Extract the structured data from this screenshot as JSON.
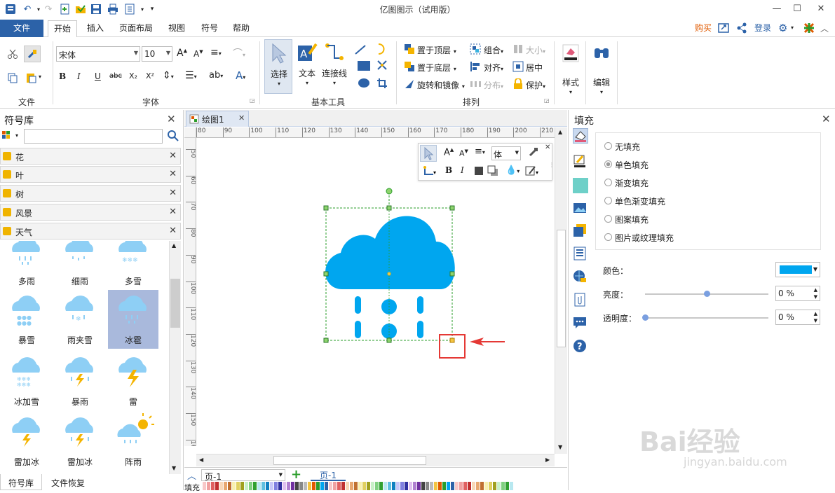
{
  "app": {
    "title": "亿图图示（试用版）"
  },
  "menu": {
    "file": "文件",
    "tabs": [
      "开始",
      "插入",
      "页面布局",
      "视图",
      "符号",
      "帮助"
    ],
    "buy": "购买",
    "login": "登录"
  },
  "ribbon": {
    "groups": {
      "file": "文件",
      "font": "字体",
      "basic_tools": "基本工具",
      "arrange": "排列",
      "style": "样式",
      "edit": "编辑"
    },
    "font_name": "宋体",
    "font_size": "10",
    "select": "选择",
    "text": "文本",
    "connector": "连接线",
    "bring_front": "置于顶层",
    "send_back": "置于底层",
    "rotate_mirror": "旋转和镜像",
    "group": "组合",
    "align": "对齐",
    "distribute": "分布",
    "size": "大小",
    "center": "居中",
    "protect": "保护",
    "bold": "B",
    "italic": "I",
    "underline": "U",
    "strike": "abc",
    "sub": "X₂",
    "sup": "X²"
  },
  "left_panel": {
    "title": "符号库",
    "search_placeholder": "",
    "categories": [
      "花",
      "叶",
      "树",
      "风景",
      "天气"
    ],
    "symbols": [
      "多雨",
      "细雨",
      "多雪",
      "暴雪",
      "雨夹雪",
      "冰雹",
      "冰加雪",
      "暴雨",
      "雷",
      "雷加冰",
      "雷加冰",
      "阵雨"
    ],
    "bottom_tabs": [
      "符号库",
      "文件恢复"
    ]
  },
  "canvas": {
    "tab": "绘图1",
    "ruler_top": [
      "80",
      "90",
      "100",
      "110",
      "120",
      "130",
      "140",
      "150",
      "160",
      "170",
      "180",
      "190",
      "200",
      "210"
    ],
    "ruler_left": [
      "50",
      "60",
      "70",
      "80",
      "90",
      "100",
      "110",
      "120",
      "130",
      "140",
      "150",
      "160"
    ],
    "mini_font": "体",
    "page_select": "页-1",
    "page_tab": "页-1",
    "fill_label": "填充"
  },
  "right_panel": {
    "title": "填充",
    "options": [
      "无填充",
      "单色填充",
      "渐变填充",
      "单色渐变填充",
      "图案填充",
      "图片或纹理填充"
    ],
    "selected_option": "单色填充",
    "color_label": "颜色：",
    "color_value": "#00a6ef",
    "brightness_label": "亮度：",
    "brightness_value": "0 %",
    "brightness_level": 0.5,
    "transparency_label": "透明度：",
    "transparency_value": "0 %",
    "transparency_level": 0
  },
  "watermark": {
    "brand": "Bai经验",
    "url": "jingyan.baidu.com"
  },
  "colors": {
    "accent": "#2c62a8",
    "cloud": "#00a6ef",
    "symbol": "#8ecff5",
    "buy": "#e05a00",
    "red": "#e53935"
  }
}
